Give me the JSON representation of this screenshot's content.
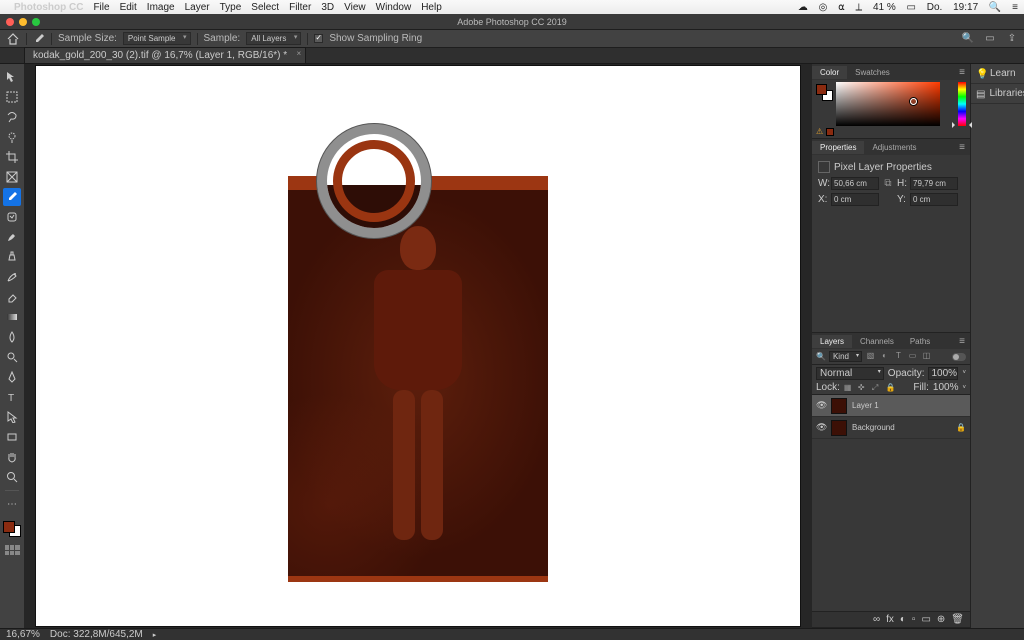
{
  "os_menubar": {
    "app": "Photoshop CC",
    "items": [
      "File",
      "Edit",
      "Image",
      "Layer",
      "Type",
      "Select",
      "Filter",
      "3D",
      "View",
      "Window",
      "Help"
    ],
    "right": {
      "battery": "41 %",
      "day": "Do.",
      "time": "19:17"
    }
  },
  "window": {
    "title": "Adobe Photoshop CC 2019"
  },
  "options_bar": {
    "sample_size_label": "Sample Size:",
    "sample_size_value": "Point Sample",
    "sample_label": "Sample:",
    "sample_value": "All Layers",
    "show_ring_label": "Show Sampling Ring"
  },
  "document_tab": {
    "title": "kodak_gold_200_30 (2).tif @ 16,7% (Layer 1, RGB/16*) *"
  },
  "statusbar": {
    "zoom": "16,67%",
    "doc": "Doc: 322,8M/645,2M"
  },
  "color_panel": {
    "tabs": [
      "Color",
      "Swatches"
    ]
  },
  "properties_panel": {
    "tabs": [
      "Properties",
      "Adjustments"
    ],
    "type_label": "Pixel Layer Properties",
    "W_label": "W:",
    "W": "50,66 cm",
    "H_label": "H:",
    "H": "79,79 cm",
    "X_label": "X:",
    "X": "0 cm",
    "Y_label": "Y:",
    "Y": "0 cm"
  },
  "layers_panel": {
    "tabs": [
      "Layers",
      "Channels",
      "Paths"
    ],
    "kind_label": "Kind",
    "blend_mode": "Normal",
    "opacity_label": "Opacity:",
    "opacity": "100%",
    "lock_label": "Lock:",
    "fill_label": "Fill:",
    "fill": "100%",
    "layers": [
      {
        "name": "Layer 1",
        "selected": true,
        "locked": false
      },
      {
        "name": "Background",
        "selected": false,
        "locked": true
      }
    ],
    "footer_icons": [
      "∞",
      "fx",
      "◐",
      "▫",
      "▭",
      "⊕",
      "🗑"
    ]
  },
  "side_dock": {
    "items": [
      "Learn",
      "Libraries"
    ]
  },
  "colors": {
    "foreground": "#8a2b10",
    "background": "#ffffff"
  }
}
